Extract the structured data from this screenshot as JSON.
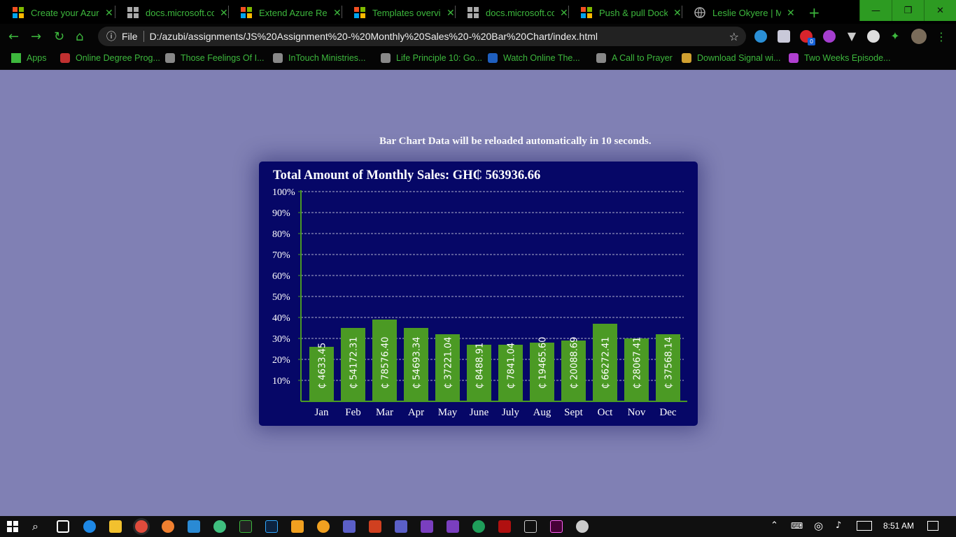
{
  "browser": {
    "tabs": [
      {
        "title": "Create your Azure",
        "icon": "microsoft-icon"
      },
      {
        "title": "docs.microsoft.com",
        "icon": "microsoft-gray-icon"
      },
      {
        "title": "Extend Azure Reso",
        "icon": "microsoft-icon"
      },
      {
        "title": "Templates overview",
        "icon": "microsoft-icon"
      },
      {
        "title": "docs.microsoft.com",
        "icon": "microsoft-gray-icon"
      },
      {
        "title": "Push & pull Docker",
        "icon": "microsoft-icon"
      },
      {
        "title": "Leslie Okyere | Mo",
        "icon": "globe-icon"
      }
    ],
    "new_tab": "+",
    "address": {
      "info": "ⓘ",
      "scheme_label": "File",
      "url": "D:/azubi/assignments/JS%20Assignment%20-%20Monthly%20Sales%20-%20Bar%20Chart/index.html"
    },
    "bookmarks": [
      "Apps",
      "Online Degree Prog...",
      "Those Feelings Of I...",
      "InTouch Ministries...",
      "Life Principle 10: Go...",
      "Watch Online The...",
      "A Call to Prayer",
      "Download Signal wi...",
      "Two Weeks Episode..."
    ],
    "extension_badge": "0"
  },
  "page": {
    "reload_note": "Bar Chart Data will be reloaded automatically in 10 seconds."
  },
  "chart_data": {
    "type": "bar",
    "title": "Total Amount of Monthly Sales: GH₵ 563936.66",
    "categories": [
      "Jan",
      "Feb",
      "Mar",
      "Apr",
      "May",
      "June",
      "July",
      "Aug",
      "Sept",
      "Oct",
      "Nov",
      "Dec"
    ],
    "values_percent": [
      26,
      35,
      39,
      35,
      32,
      27,
      27,
      28,
      29,
      37,
      30,
      32
    ],
    "data_labels": [
      "₵ 4633.45",
      "₵ 54172.31",
      "₵ 78576.40",
      "₵ 54693.34",
      "₵ 37221.04",
      "₵ 8488.91",
      "₵ 7841.04",
      "₵ 19465.60",
      "₵ 20088.69",
      "₵ 66272.41",
      "₵ 28067.41",
      "₵ 37568.14"
    ],
    "yticks": [
      "10%",
      "20%",
      "30%",
      "40%",
      "50%",
      "60%",
      "70%",
      "80%",
      "90%",
      "100%"
    ],
    "ylim": [
      0,
      100
    ],
    "grid": true,
    "colors": {
      "background": "#060767",
      "bar": "#4b9a24",
      "axis": "#4b9a24",
      "grid": "#ffffff",
      "text": "#ffffff"
    }
  },
  "taskbar": {
    "clock": "8:51 AM"
  }
}
